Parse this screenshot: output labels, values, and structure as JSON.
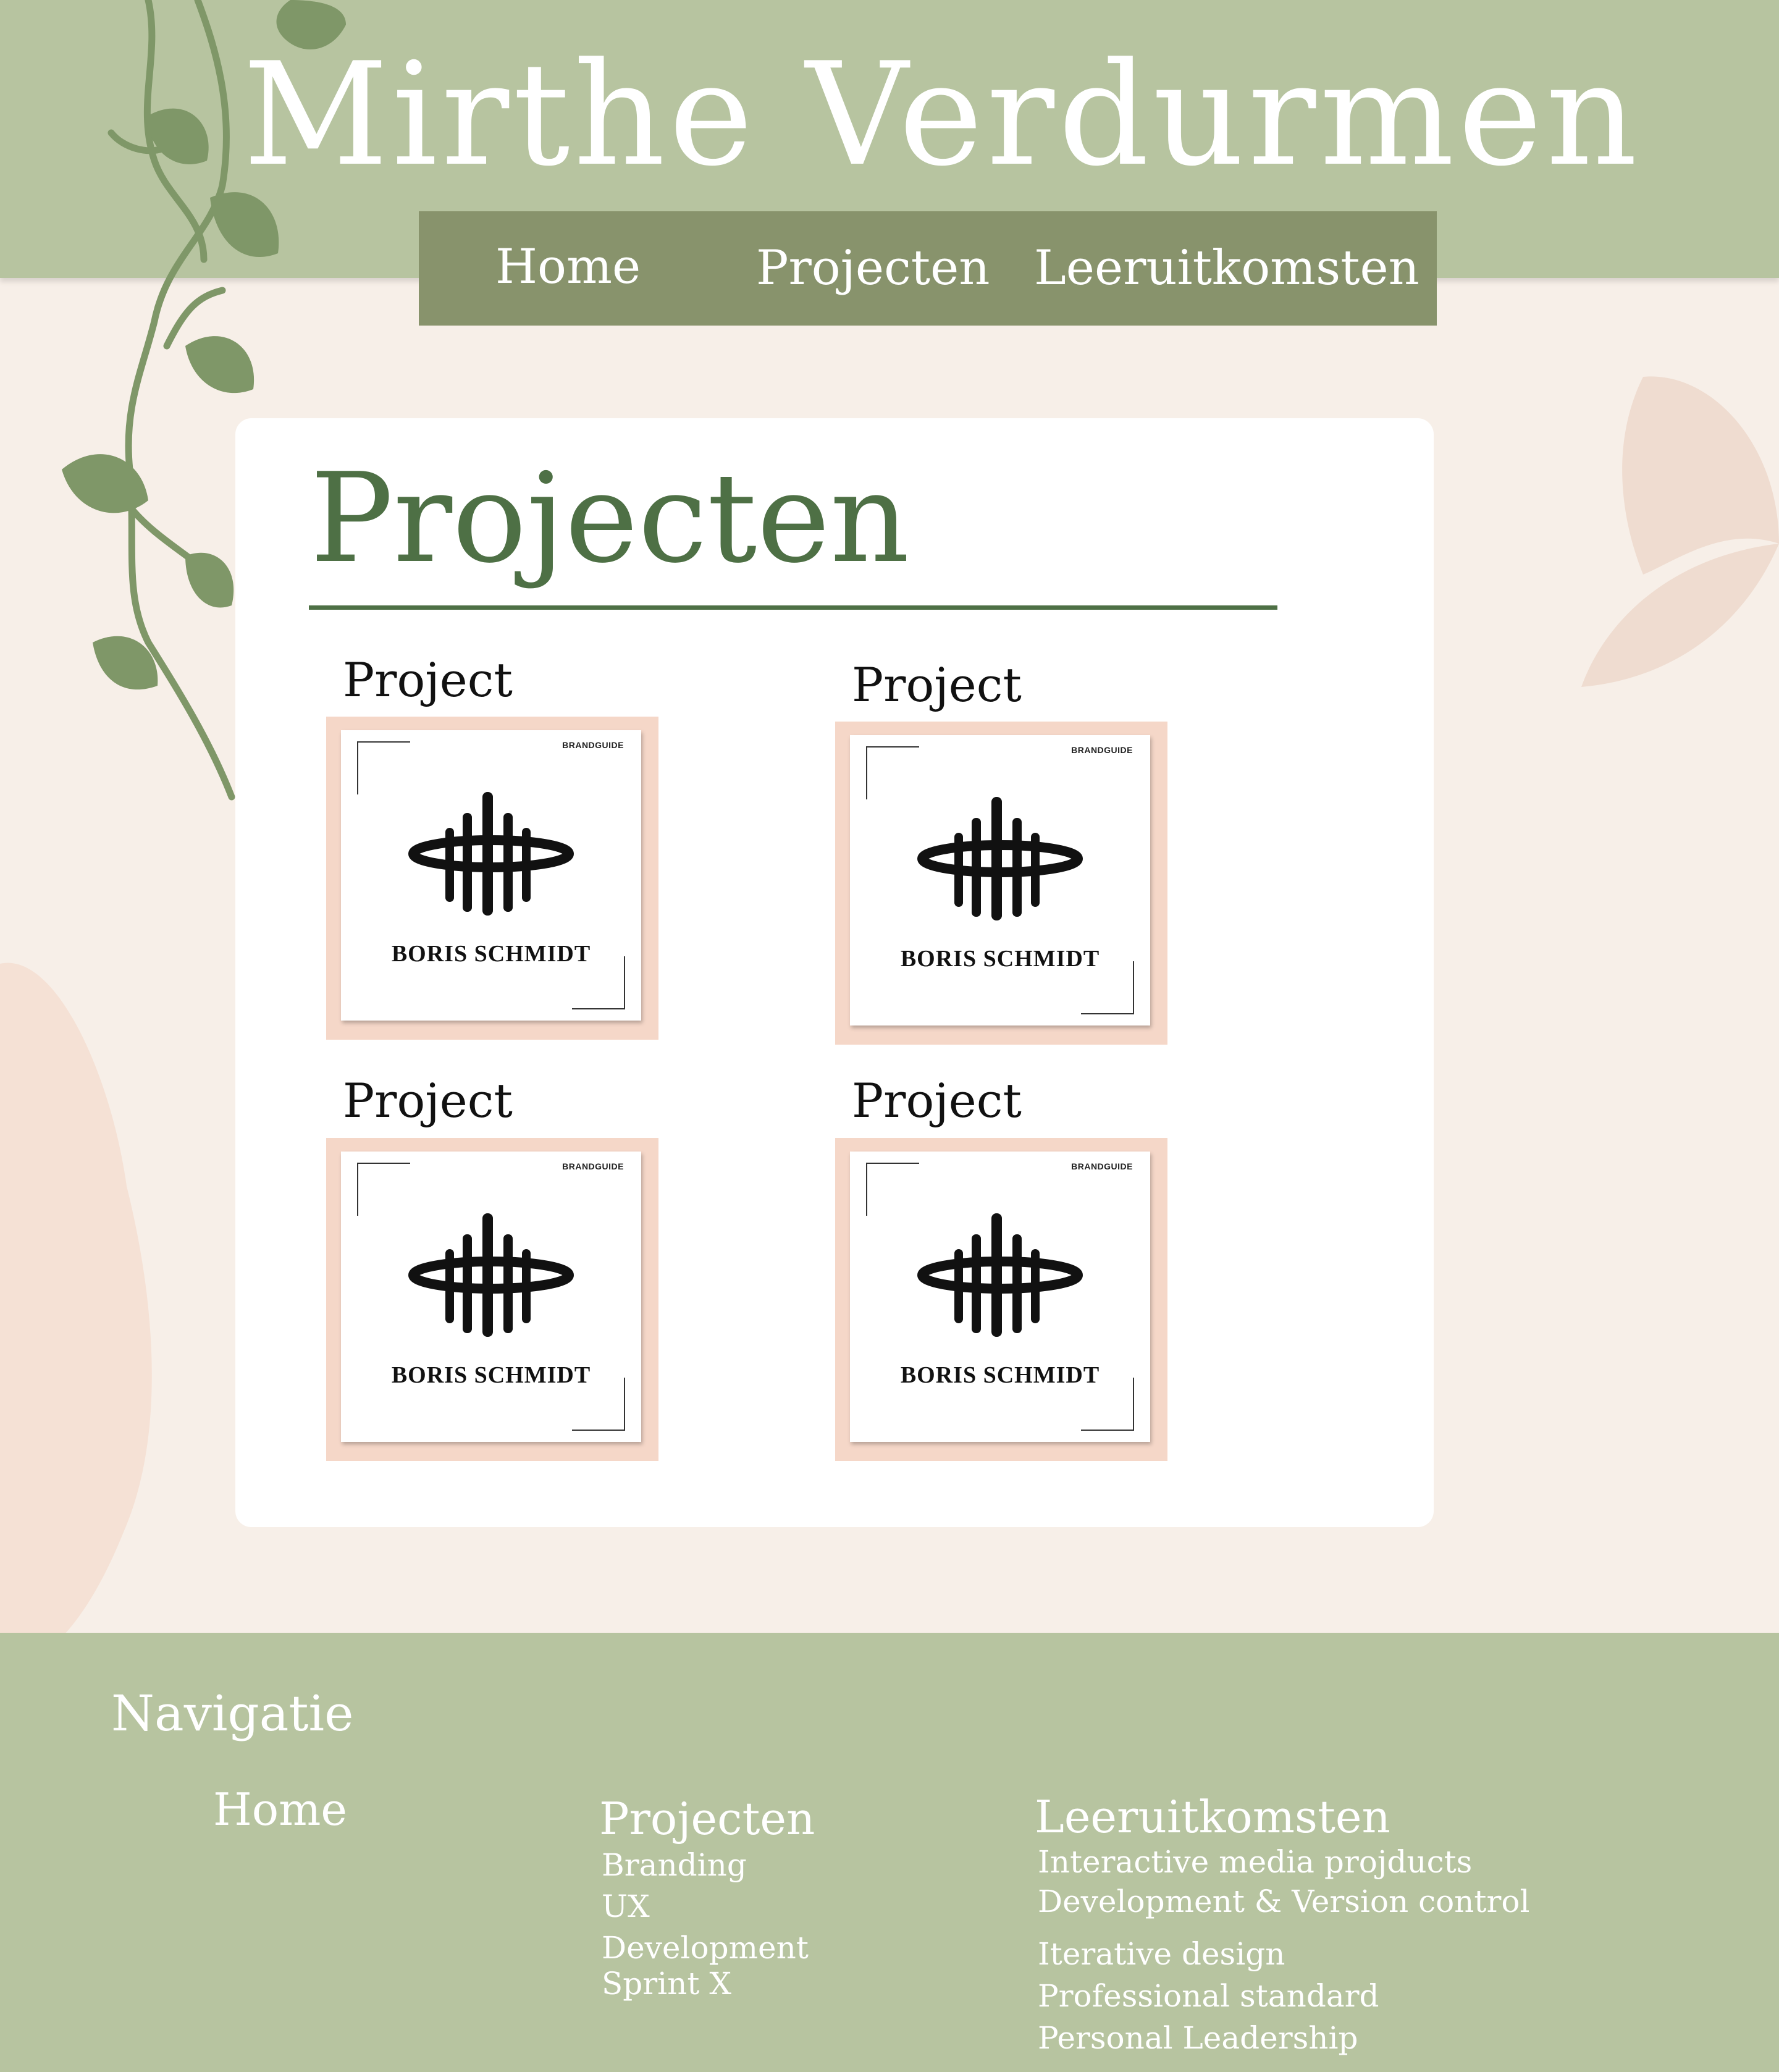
{
  "site": {
    "title": "Mirthe Verdurmen"
  },
  "nav": {
    "items": [
      {
        "label": "Home"
      },
      {
        "label": "Projecten"
      },
      {
        "label": "Leeruitkomsten"
      }
    ]
  },
  "main": {
    "section_title": "Projecten",
    "projects": [
      {
        "label": "Project",
        "badge": "BRANDGUIDE",
        "brand_name": "BORIS SCHMIDT"
      },
      {
        "label": "Project",
        "badge": "BRANDGUIDE",
        "brand_name": "BORIS SCHMIDT"
      },
      {
        "label": "Project",
        "badge": "BRANDGUIDE",
        "brand_name": "BORIS SCHMIDT"
      },
      {
        "label": "Project",
        "badge": "BRANDGUIDE",
        "brand_name": "BORIS SCHMIDT"
      }
    ]
  },
  "footer": {
    "heading": "Navigatie",
    "home": "Home",
    "projecten": {
      "title": "Projecten",
      "items": [
        "Branding",
        "UX",
        "Development",
        "Sprint X"
      ]
    },
    "leeruitkomsten": {
      "title": "Leeruitkomsten",
      "items": [
        "Interactive media projducts",
        "Development & Version control",
        "Iterative design",
        "Professional standard",
        "Personal Leadership"
      ]
    }
  },
  "colors": {
    "header_green": "#b7c4a0",
    "nav_green": "#88936c",
    "title_green": "#4e7045",
    "page_background": "#f7efe8",
    "thumb_border": "#f5d7c8",
    "leaf_green": "#7f9768"
  }
}
